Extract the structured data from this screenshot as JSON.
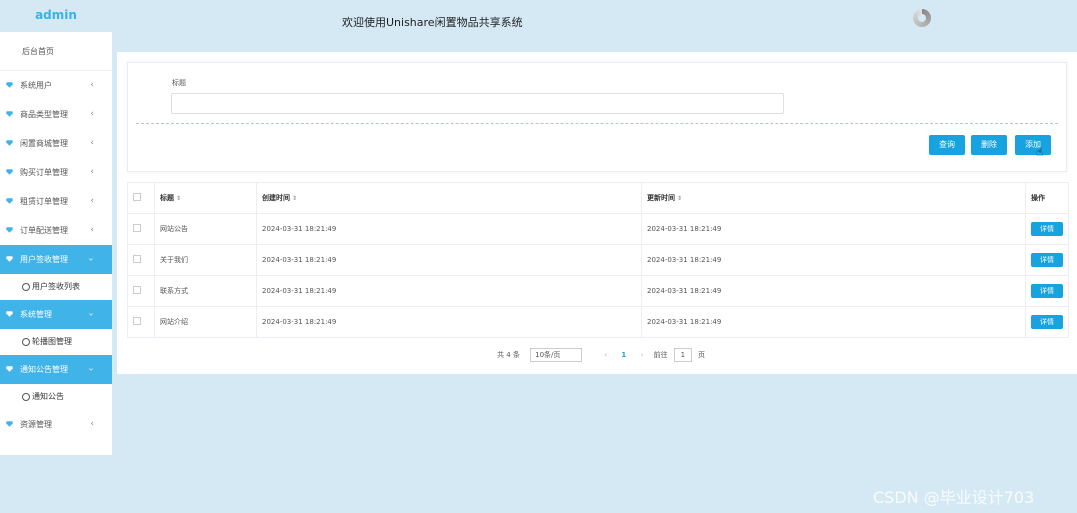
{
  "sidebar": {
    "brand": "admin",
    "home": "后台首页",
    "menus": [
      {
        "label": "系统用户",
        "active": false
      },
      {
        "label": "商品类型管理",
        "active": false
      },
      {
        "label": "闲置商城管理",
        "active": false
      },
      {
        "label": "购买订单管理",
        "active": false
      },
      {
        "label": "租赁订单管理",
        "active": false
      },
      {
        "label": "订单配送管理",
        "active": false
      },
      {
        "label": "用户签收管理",
        "active": true,
        "sub": "用户签收列表"
      },
      {
        "label": "系统管理",
        "active": true,
        "sub": "轮播图管理"
      },
      {
        "label": "通知公告管理",
        "active": true,
        "sub": "通知公告"
      },
      {
        "label": "资源管理",
        "active": false
      }
    ],
    "menu_icon_color": "#40b4e8"
  },
  "header": {
    "title": "欢迎使用Unishare闲置物品共享系统"
  },
  "search": {
    "label": "标题",
    "value": ""
  },
  "buttons": {
    "query": "查询",
    "delete": "删除",
    "add": "添加"
  },
  "table": {
    "columns": [
      "标题",
      "创建时间",
      "更新时间",
      "操作"
    ],
    "rows": [
      {
        "title": "网站公告",
        "created": "2024-03-31 18:21:49",
        "updated": "2024-03-31 18:21:49",
        "action": "详情"
      },
      {
        "title": "关于我们",
        "created": "2024-03-31 18:21:49",
        "updated": "2024-03-31 18:21:49",
        "action": "详情"
      },
      {
        "title": "联系方式",
        "created": "2024-03-31 18:21:49",
        "updated": "2024-03-31 18:21:49",
        "action": "详情"
      },
      {
        "title": "网站介绍",
        "created": "2024-03-31 18:21:49",
        "updated": "2024-03-31 18:21:49",
        "action": "详情"
      }
    ]
  },
  "pagination": {
    "total": "共 4 条",
    "page_size": "10条/页",
    "current_page": "1",
    "goto_label": "前往",
    "goto_value": "1",
    "page_suffix": "页"
  },
  "watermark": "CSDN @毕业设计703",
  "accent_color": "#16a3e0"
}
